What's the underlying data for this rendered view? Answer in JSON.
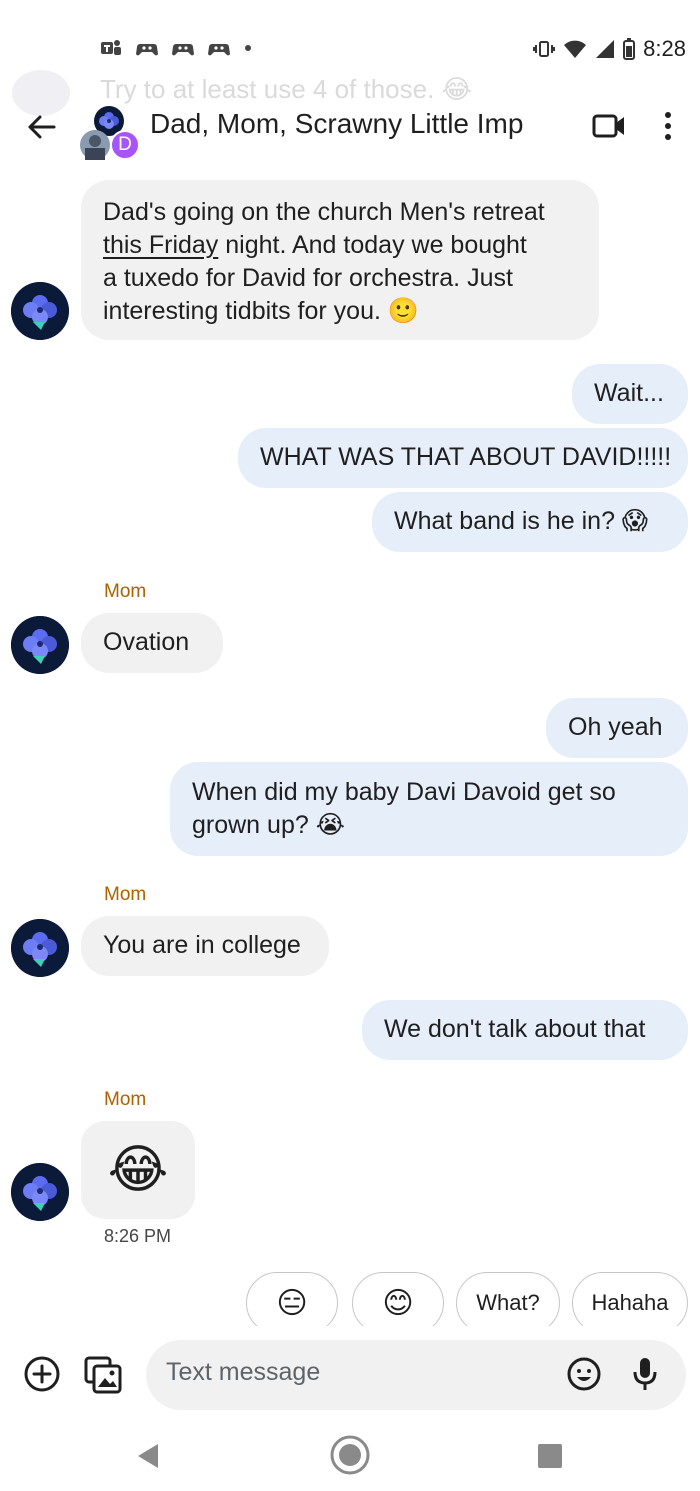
{
  "status_bar": {
    "time": "8:28",
    "left_icons": [
      "teams-icon",
      "game-controller-icon",
      "game-controller-icon",
      "game-controller-icon",
      "dot-icon"
    ],
    "right_icons": [
      "vibrate-icon",
      "wifi-icon",
      "signal-icon",
      "battery-icon"
    ]
  },
  "behind_text": "Try to at least use 4 of those. 😂",
  "header": {
    "title": "Dad, Mom, Scrawny Little Imp",
    "avatar_letter": "D",
    "avatar_letter_color": "#a855f7"
  },
  "messages": [
    {
      "dir": "in",
      "line1_a": "Dad's going on the church Men's retreat",
      "line2_underlined": "this Friday",
      "line2_rest": " night.  And today we bought",
      "line3": "a tuxedo for David for orchestra.  Just",
      "line4": "interesting tidbits for you. 🙂"
    },
    {
      "dir": "out",
      "text": "Wait..."
    },
    {
      "dir": "out",
      "text": "WHAT WAS THAT ABOUT DAVID!!!!!"
    },
    {
      "dir": "out",
      "text": "What band is he in? 😱"
    },
    {
      "dir": "in",
      "sender": "Mom",
      "text": "Ovation"
    },
    {
      "dir": "out",
      "text": "Oh yeah"
    },
    {
      "dir": "out",
      "line1": "When did my baby Davi Davoid get so",
      "line2": "grown up? 😭"
    },
    {
      "dir": "in",
      "sender": "Mom",
      "text": "You are in college"
    },
    {
      "dir": "out",
      "text": "We don't talk about that"
    },
    {
      "dir": "in",
      "sender": "Mom",
      "text": "😂",
      "time": "8:26 PM"
    }
  ],
  "suggestions": [
    "😑",
    "😊",
    "What?",
    "Hahaha"
  ],
  "compose": {
    "placeholder": "Text message"
  },
  "colors": {
    "incoming_bubble": "#f1f1f1",
    "outgoing_bubble": "#e6eefa",
    "sender_name": "#b06000",
    "avatar_bg": "#0c1a3a"
  }
}
